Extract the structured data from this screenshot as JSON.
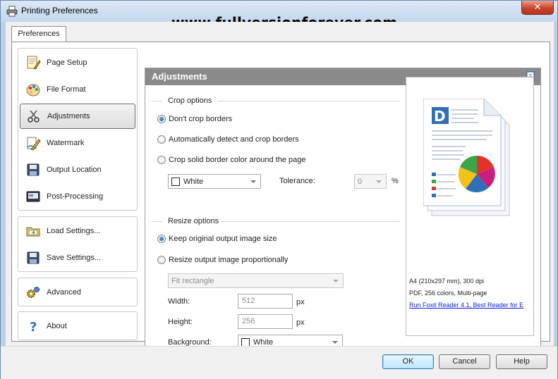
{
  "window": {
    "title": "Printing Preferences",
    "watermark": "www.fullversionforever.com",
    "close_label": "✕"
  },
  "tabs": [
    {
      "label": "Preferences"
    }
  ],
  "sidebar": {
    "items": [
      {
        "label": "Page Setup",
        "icon": "page-setup-icon"
      },
      {
        "label": "File Format",
        "icon": "palette-icon"
      },
      {
        "label": "Adjustments",
        "icon": "scissors-icon",
        "active": true
      },
      {
        "label": "Watermark",
        "icon": "watermark-icon"
      },
      {
        "label": "Output Location",
        "icon": "floppy-icon"
      },
      {
        "label": "Post-Processing",
        "icon": "post-processing-icon"
      }
    ],
    "settings": [
      {
        "label": "Load Settings...",
        "icon": "folder-icon"
      },
      {
        "label": "Save Settings...",
        "icon": "save-icon"
      }
    ],
    "advanced": {
      "label": "Advanced",
      "icon": "gears-icon"
    },
    "about": {
      "label": "About",
      "icon": "help-icon"
    }
  },
  "panel": {
    "title": "Adjustments",
    "crop": {
      "heading": "Crop options",
      "options": [
        {
          "label": "Don't crop borders",
          "checked": true
        },
        {
          "label": "Automatically detect and crop borders",
          "checked": false
        },
        {
          "label": "Crop solid border color around the page",
          "checked": false
        }
      ],
      "color_value": "White",
      "tolerance_label": "Tolerance:",
      "tolerance_value": "0",
      "tolerance_unit": "%"
    },
    "resize": {
      "heading": "Resize options",
      "options": [
        {
          "label": "Keep original output image size",
          "checked": true
        },
        {
          "label": "Resize output image proportionally",
          "checked": false
        }
      ],
      "mode_value": "Fit rectangle",
      "width_label": "Width:",
      "width_value": "512",
      "height_label": "Height:",
      "height_value": "256",
      "unit": "px",
      "background_label": "Background:",
      "background_value": "White"
    },
    "preview": {
      "line1": "A4 (210x297 mm), 300 dpi",
      "line2": "PDF, 256 colors, Multi-page",
      "link": "Run Foxit Reader 4.1, Best Reader for E"
    }
  },
  "buttons": {
    "ok": "OK",
    "cancel": "Cancel",
    "help": "Help"
  }
}
